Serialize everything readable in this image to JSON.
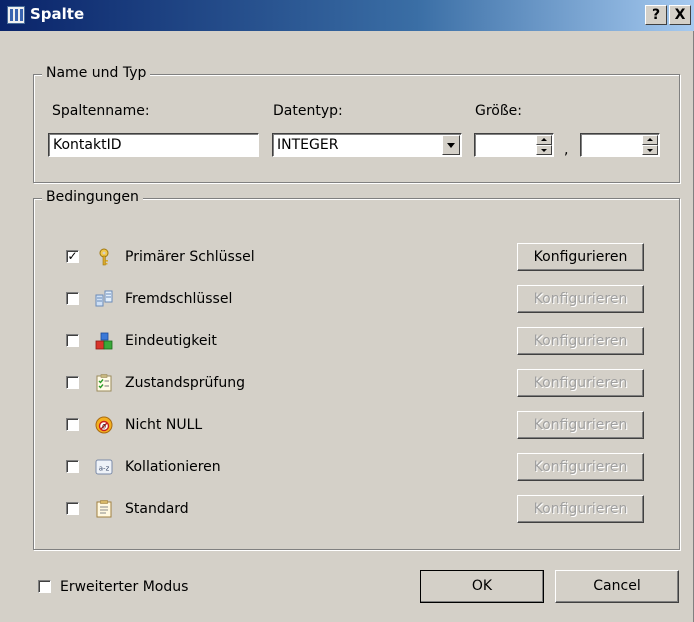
{
  "window": {
    "title": "Spalte",
    "help_label": "?",
    "close_label": "X"
  },
  "name_group": {
    "legend": "Name und Typ",
    "spaltenname_label": "Spaltenname:",
    "spaltenname_value": "KontaktID",
    "datentyp_label": "Datentyp:",
    "datentyp_value": "INTEGER",
    "groesse_label": "Größe:",
    "groesse_value": "",
    "separator": ",",
    "precision_value": ""
  },
  "constraints_group": {
    "legend": "Bedingungen",
    "items": [
      {
        "label": "Primärer Schlüssel",
        "checked": true,
        "icon": "key-icon",
        "button": "Konfigurieren",
        "enabled": true
      },
      {
        "label": "Fremdschlüssel",
        "checked": false,
        "icon": "foreign-key-icon",
        "button": "Konfigurieren",
        "enabled": false
      },
      {
        "label": "Eindeutigkeit",
        "checked": false,
        "icon": "unique-blocks-icon",
        "button": "Konfigurieren",
        "enabled": false
      },
      {
        "label": "Zustandsprüfung",
        "checked": false,
        "icon": "checklist-icon",
        "button": "Konfigurieren",
        "enabled": false
      },
      {
        "label": "Nicht NULL",
        "checked": false,
        "icon": "not-null-icon",
        "button": "Konfigurieren",
        "enabled": false
      },
      {
        "label": "Kollationieren",
        "checked": false,
        "icon": "collate-az-icon",
        "button": "Konfigurieren",
        "enabled": false
      },
      {
        "label": "Standard",
        "checked": false,
        "icon": "clipboard-icon",
        "button": "Konfigurieren",
        "enabled": false
      }
    ]
  },
  "footer": {
    "advanced_label": "Erweiterter Modus",
    "advanced_checked": false,
    "ok_label": "OK",
    "cancel_label": "Cancel"
  },
  "colors": {
    "face": "#d4d0c8",
    "title_start": "#0a246a",
    "title_end": "#a6caf0"
  }
}
